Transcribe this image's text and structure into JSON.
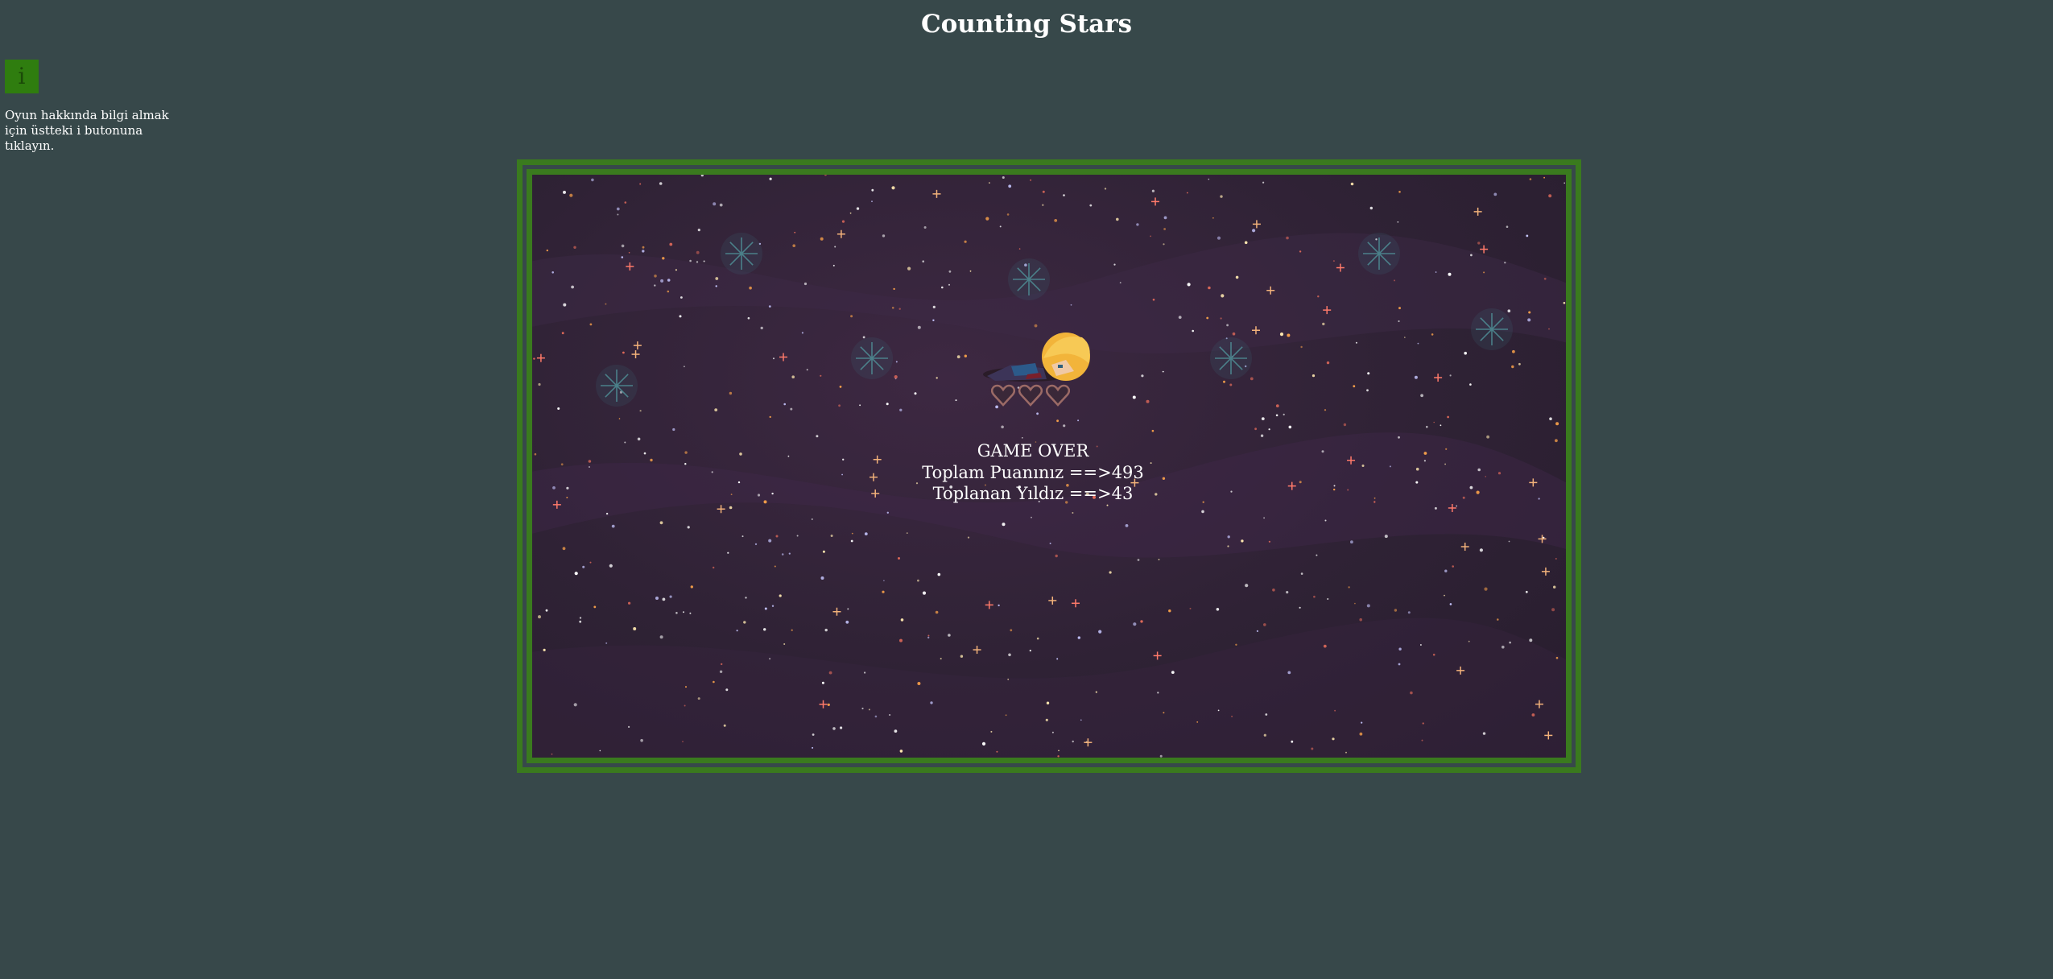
{
  "page": {
    "title": "Counting Stars"
  },
  "info": {
    "button_label": "i",
    "hint": "Oyun hakkında bilgi almak için üstteki i butonuna tıklayın."
  },
  "game": {
    "status": "GAME OVER",
    "score_text": "Toplam Puanınız ==>493",
    "stars_text": "Toplanan Yıldız ==>43",
    "lives_remaining": 0,
    "lives_total": 3
  },
  "colors": {
    "background": "#37484a",
    "frame": "#3a7a1e",
    "button": "#2f7d0f",
    "sky": "#2f2235"
  }
}
